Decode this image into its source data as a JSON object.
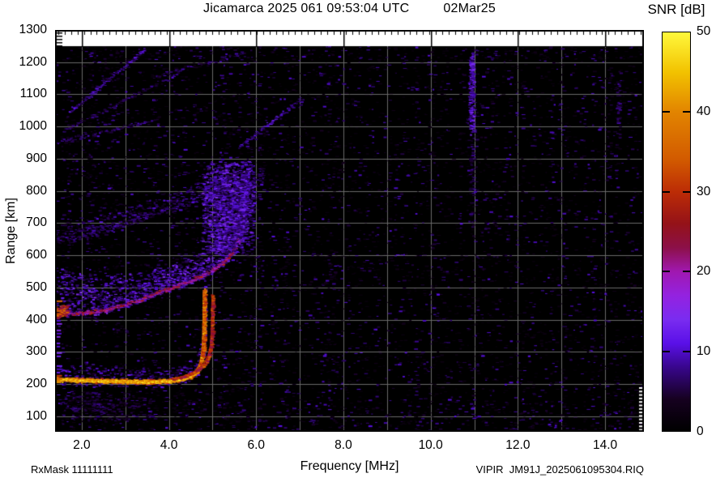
{
  "header": {
    "title": "Jicamarca 2025 061 09:53:04 UTC",
    "date": "02Mar25"
  },
  "colorbar": {
    "title": "SNR [dB]",
    "ticks": [
      "50",
      "40",
      "30",
      "20",
      "10",
      "0"
    ],
    "tick_values": [
      50,
      40,
      30,
      20,
      10,
      0
    ],
    "min": 0,
    "max": 50
  },
  "axes": {
    "x": {
      "label": "Frequency [MHz]",
      "ticks": [
        "2.0",
        "4.0",
        "6.0",
        "8.0",
        "10.0",
        "12.0",
        "14.0"
      ],
      "tick_values": [
        2,
        4,
        6,
        8,
        10,
        12,
        14
      ],
      "range": [
        1.39,
        14.89
      ],
      "minor_grid_mhz": 1.0
    },
    "y": {
      "label": "Range [km]",
      "ticks": [
        "1300",
        "1200",
        "1100",
        "1000",
        "900",
        "800",
        "700",
        "600",
        "500",
        "400",
        "300",
        "200",
        "100"
      ],
      "tick_values": [
        1300,
        1200,
        1100,
        1000,
        900,
        800,
        700,
        600,
        500,
        400,
        300,
        200,
        100
      ],
      "range": [
        52,
        1300
      ],
      "data_range_km": [
        52,
        1250
      ],
      "grid_km": 100
    }
  },
  "footer": {
    "rxmask": "RxMask 11111111",
    "filename": "VIPIR  JM91J_2025061095304.RIQ"
  },
  "chart_data": {
    "type": "heatmap",
    "title": "Jicamarca ionogram, SNR [dB] vs frequency and virtual range",
    "xlabel": "Frequency [MHz]",
    "ylabel": "Range [km]",
    "xlim": [
      1.39,
      14.89
    ],
    "ylim": [
      52,
      1300
    ],
    "grid": {
      "on": true,
      "color": "#6a6a6a",
      "x_step_mhz": 1.0,
      "y_step_km": 100
    },
    "background_color": "#000000",
    "blank_band_km": [
      1250,
      1300
    ],
    "palette_stops": [
      [
        0,
        "#000000"
      ],
      [
        4,
        "#160120"
      ],
      [
        8,
        "#38068c"
      ],
      [
        11,
        "#5a10e8"
      ],
      [
        14,
        "#7a2cf0"
      ],
      [
        17,
        "#9422e0"
      ],
      [
        20,
        "#a018b0"
      ],
      [
        23,
        "#8c1048"
      ],
      [
        26,
        "#941218"
      ],
      [
        30,
        "#bc2c06"
      ],
      [
        34,
        "#d25a00"
      ],
      [
        40,
        "#e28400"
      ],
      [
        45,
        "#f2c200"
      ],
      [
        50,
        "#fff83c"
      ]
    ],
    "seed": 20250302,
    "noise": {
      "count": 15000,
      "v_range": [
        2,
        11
      ],
      "col_stripe_chance": 0.07,
      "top_band_boost": 1.9,
      "bottom_band_boost": 1.8
    },
    "traces": [
      {
        "name": "E-layer-fuzz",
        "pts": [
          [
            1.39,
            216
          ],
          [
            1.8,
            214
          ],
          [
            2.3,
            212
          ],
          [
            2.9,
            210
          ],
          [
            3.5,
            209
          ],
          [
            3.9,
            210
          ],
          [
            4.15,
            213
          ],
          [
            4.35,
            219
          ],
          [
            4.5,
            228
          ],
          [
            4.62,
            241
          ],
          [
            4.7,
            258
          ],
          [
            4.745,
            280
          ],
          [
            4.77,
            310
          ],
          [
            4.785,
            345
          ],
          [
            4.79,
            385
          ],
          [
            4.795,
            440
          ],
          [
            4.8,
            492
          ]
        ],
        "up": 55,
        "down": 22,
        "density": 2,
        "v": [
          4,
          13
        ]
      },
      {
        "name": "E-layer-core",
        "pts": [
          [
            1.39,
            216
          ],
          [
            1.8,
            214
          ],
          [
            2.3,
            212
          ],
          [
            2.9,
            210
          ],
          [
            3.5,
            209
          ],
          [
            3.9,
            210
          ],
          [
            4.15,
            213
          ],
          [
            4.35,
            219
          ],
          [
            4.5,
            228
          ],
          [
            4.62,
            241
          ],
          [
            4.7,
            258
          ],
          [
            4.745,
            280
          ],
          [
            4.77,
            310
          ],
          [
            4.785,
            345
          ],
          [
            4.79,
            385
          ],
          [
            4.795,
            440
          ],
          [
            4.8,
            492
          ]
        ],
        "up": 8,
        "down": 8,
        "density": 4,
        "v": [
          28,
          46
        ],
        "stroke": 38,
        "lw": 2.5
      },
      {
        "name": "E-layer-hot",
        "pts": [
          [
            1.39,
            216
          ],
          [
            1.8,
            214
          ],
          [
            2.3,
            212
          ],
          [
            2.9,
            210
          ],
          [
            3.5,
            209
          ],
          [
            3.9,
            210
          ],
          [
            4.15,
            213
          ],
          [
            4.35,
            219
          ],
          [
            4.5,
            228
          ]
        ],
        "up": 4,
        "down": 4,
        "density": 3,
        "v": [
          38,
          50
        ]
      },
      {
        "name": "E-layer-xmode-cusp",
        "pts": [
          [
            4.05,
            216
          ],
          [
            4.3,
            223
          ],
          [
            4.5,
            233
          ],
          [
            4.66,
            246
          ],
          [
            4.8,
            263
          ],
          [
            4.9,
            288
          ],
          [
            4.95,
            320
          ],
          [
            4.975,
            365
          ],
          [
            4.985,
            420
          ],
          [
            4.99,
            478
          ]
        ],
        "up": 5,
        "down": 5,
        "density": 2,
        "v": [
          22,
          36
        ],
        "stroke": 30,
        "lw": 1.5
      },
      {
        "name": "F-layer-diffuse",
        "pts": [
          [
            1.39,
            415,
            150
          ],
          [
            1.7,
            419,
            140
          ],
          [
            2.0,
            421,
            130
          ],
          [
            2.3,
            425,
            118
          ],
          [
            2.55,
            430,
            110
          ],
          [
            2.96,
            447,
            98
          ],
          [
            3.3,
            460,
            90
          ],
          [
            3.7,
            482,
            84
          ],
          [
            3.98,
            495,
            80
          ],
          [
            4.35,
            515,
            76
          ],
          [
            4.72,
            535,
            78
          ],
          [
            5.0,
            555,
            82
          ],
          [
            5.28,
            583,
            92
          ],
          [
            5.46,
            613,
            102
          ],
          [
            5.59,
            651,
            112
          ],
          [
            5.69,
            694,
            118
          ],
          [
            5.74,
            734,
            110
          ],
          [
            5.76,
            769,
            80
          ],
          [
            5.74,
            800,
            55
          ]
        ],
        "up": 90,
        "down": 10,
        "density": 5,
        "v": [
          5,
          15
        ]
      },
      {
        "name": "F-layer-edge-speckle",
        "pts": [
          [
            1.39,
            415
          ],
          [
            1.7,
            419
          ],
          [
            2.0,
            421
          ],
          [
            2.3,
            425
          ],
          [
            2.55,
            430
          ],
          [
            2.96,
            447
          ],
          [
            3.3,
            460
          ],
          [
            3.7,
            482
          ],
          [
            3.98,
            495
          ],
          [
            4.35,
            515
          ],
          [
            4.72,
            535
          ],
          [
            5.0,
            555
          ],
          [
            5.28,
            583
          ],
          [
            5.46,
            613
          ],
          [
            5.59,
            651
          ]
        ],
        "up": 8,
        "down": 5,
        "density": 1.2,
        "v": [
          18,
          30
        ]
      },
      {
        "name": "F-layer-left-hotspot",
        "pts": [
          [
            1.39,
            416
          ],
          [
            1.65,
            420
          ]
        ],
        "up": 28,
        "down": 12,
        "density": 8,
        "v": [
          22,
          40
        ]
      },
      {
        "name": "F-second-hop",
        "pts": [
          [
            1.39,
            648
          ],
          [
            2.0,
            664
          ],
          [
            2.73,
            689
          ],
          [
            3.33,
            719
          ],
          [
            4.07,
            752
          ],
          [
            4.81,
            782
          ],
          [
            5.55,
            810
          ],
          [
            6.15,
            830
          ]
        ],
        "up": 55,
        "down": 18,
        "density": 2.2,
        "v": [
          4,
          11
        ]
      },
      {
        "name": "hop-streak-0",
        "pts": [
          [
            1.39,
            953
          ],
          [
            3.66,
            1021
          ]
        ],
        "up": 10,
        "down": 10,
        "density": 0.6,
        "v": [
          4,
          10
        ]
      },
      {
        "name": "hop-streak-1",
        "pts": [
          [
            1.72,
            1048
          ],
          [
            3.44,
            1242
          ]
        ],
        "up": 8,
        "down": 8,
        "density": 0.9,
        "v": [
          5,
          13
        ]
      },
      {
        "name": "hop-streak-2",
        "pts": [
          [
            1.59,
            991
          ],
          [
            4.19,
            1167
          ]
        ],
        "up": 8,
        "down": 8,
        "density": 0.5,
        "v": [
          4,
          9
        ]
      },
      {
        "name": "hop-streak-3",
        "pts": [
          [
            5.56,
            935
          ],
          [
            7.04,
            1091
          ]
        ],
        "up": 9,
        "down": 9,
        "density": 0.8,
        "v": [
          5,
          13
        ]
      },
      {
        "name": "hop-streak-4",
        "pts": [
          [
            3.57,
            1154
          ],
          [
            5.71,
            1230
          ]
        ],
        "up": 7,
        "down": 7,
        "density": 0.6,
        "v": [
          4,
          10
        ]
      }
    ],
    "clouds": [
      {
        "name": "spread-F-blob",
        "f": [
          4.73,
          5.95
        ],
        "r": [
          605,
          895
        ],
        "n": 2600,
        "v": [
          5,
          15
        ]
      },
      {
        "name": "below-E-scatter",
        "f": [
          1.39,
          3.6
        ],
        "r": [
          85,
          180
        ],
        "n": 420,
        "v": [
          3,
          8
        ]
      },
      {
        "name": "rfi-stripe-10.9MHz-top",
        "f": [
          10.86,
          10.98
        ],
        "r": [
          975,
          1235
        ],
        "n": 300,
        "v": [
          7,
          15
        ]
      },
      {
        "name": "rfi-stripe-10.9MHz-tail",
        "f": [
          10.86,
          10.98
        ],
        "r": [
          690,
          975
        ],
        "n": 90,
        "v": [
          4,
          9
        ]
      },
      {
        "name": "rfi-stripe-14.3MHz",
        "f": [
          14.24,
          14.34
        ],
        "r": [
          930,
          1190
        ],
        "n": 80,
        "v": [
          4,
          9
        ]
      }
    ]
  }
}
